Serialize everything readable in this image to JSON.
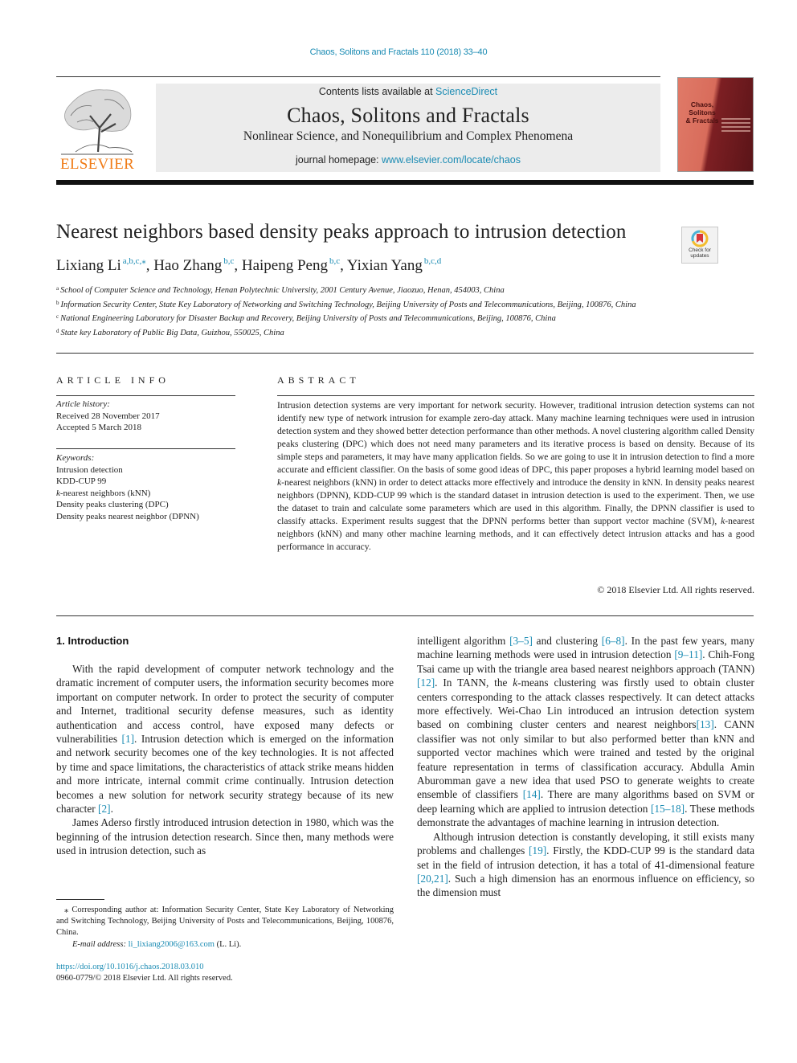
{
  "header": {
    "citation": "Chaos, Solitons and Fractals 110 (2018) 33–40",
    "contents_prefix": "Contents lists available at ",
    "contents_link": "ScienceDirect",
    "journal_name": "Chaos, Solitons and Fractals",
    "journal_subtitle": "Nonlinear Science, and Nonequilibrium and Complex Phenomena",
    "homepage_prefix": "journal homepage: ",
    "homepage_link": "www.elsevier.com/locate/chaos",
    "publisher": "ELSEVIER",
    "cover_title_lines": [
      "Chaos,",
      "Solitons",
      "& Fractals"
    ],
    "check_updates": [
      "Check for",
      "updates"
    ]
  },
  "article": {
    "title": "Nearest neighbors based density peaks approach to intrusion detection",
    "authors": [
      {
        "name": "Lixiang Li",
        "affil": "a,b,c,⁎"
      },
      {
        "name": "Hao Zhang",
        "affil": "b,c"
      },
      {
        "name": "Haipeng Peng",
        "affil": "b,c"
      },
      {
        "name": "Yixian Yang",
        "affil": "b,c,d"
      }
    ],
    "affiliations": [
      {
        "key": "a",
        "text": "School of Computer Science and Technology, Henan Polytechnic University, 2001 Century Avenue, Jiaozuo, Henan, 454003, China"
      },
      {
        "key": "b",
        "text": "Information Security Center, State Key Laboratory of Networking and Switching Technology, Beijing University of Posts and Telecommunications, Beijing, 100876, China"
      },
      {
        "key": "c",
        "text": "National Engineering Laboratory for Disaster Backup and Recovery, Beijing University of Posts and Telecommunications, Beijing, 100876, China"
      },
      {
        "key": "d",
        "text": "State key Laboratory of Public Big Data, Guizhou, 550025, China"
      }
    ]
  },
  "article_info": {
    "heading": "ARTICLE INFO",
    "history_label": "Article history:",
    "received": "Received 28 November 2017",
    "accepted": "Accepted 5 March 2018",
    "keywords_label": "Keywords:",
    "keywords": [
      "Intrusion detection",
      "KDD-CUP 99",
      "k-nearest neighbors (kNN)",
      "Density peaks clustering (DPC)",
      "Density peaks nearest neighbor (DPNN)"
    ]
  },
  "abstract": {
    "heading": "ABSTRACT",
    "text": "Intrusion detection systems are very important for network security. However, traditional intrusion detection systems can not identify new type of network intrusion for example zero-day attack. Many machine learning techniques were used in intrusion detection system and they showed better detection performance than other methods. A novel clustering algorithm called Density peaks clustering (DPC) which does not need many parameters and its iterative process is based on density. Because of its simple steps and parameters, it may have many application fields. So we are going to use it in intrusion detection to find a more accurate and efficient classifier. On the basis of some good ideas of DPC, this paper proposes a hybrid learning model based on k-nearest neighbors (kNN) in order to detect attacks more effectively and introduce the density in kNN. In density peaks nearest neighbors (DPNN), KDD-CUP 99 which is the standard dataset in intrusion detection is used to the experiment. Then, we use the dataset to train and calculate some parameters which are used in this algorithm. Finally, the DPNN classifier is used to classify attacks. Experiment results suggest that the DPNN performs better than support vector machine (SVM), k-nearest neighbors (kNN) and many other machine learning methods, and it can effectively detect intrusion attacks and has a good performance in accuracy.",
    "copyright": "© 2018 Elsevier Ltd. All rights reserved."
  },
  "body": {
    "section_heading": "1. Introduction",
    "left_paragraphs": [
      [
        {
          "t": "With the rapid development of computer network technology and the dramatic increment of computer users, the information security becomes more important on computer network. In order to protect the security of computer and Internet, traditional security defense measures, such as identity authentication and access control, have exposed many defects or vulnerabilities "
        },
        {
          "ref": "[1]"
        },
        {
          "t": ". Intrusion detection which is emerged on the information and network security becomes one of the key technologies. It is not affected by time and space limitations, the characteristics of attack strike means hidden and more intricate, internal commit crime continually. Intrusion detection becomes a new solution for network security strategy because of its new character "
        },
        {
          "ref": "[2]"
        },
        {
          "t": "."
        }
      ],
      [
        {
          "t": "James Aderso firstly introduced intrusion detection in 1980, which was the beginning of the intrusion detection research. Since then, many methods were used in intrusion detection, such as"
        }
      ]
    ],
    "right_paragraphs": [
      [
        {
          "t": "intelligent algorithm "
        },
        {
          "ref": "[3–5]"
        },
        {
          "t": " and clustering "
        },
        {
          "ref": "[6–8]"
        },
        {
          "t": ". In the past few years, many machine learning methods were used in intrusion detection "
        },
        {
          "ref": "[9–11]"
        },
        {
          "t": ". Chih-Fong Tsai came up with the triangle area based nearest neighbors approach (TANN) "
        },
        {
          "ref": "[12]"
        },
        {
          "t": ". In TANN, the k-means clustering was firstly used to obtain cluster centers corresponding to the attack classes respectively. It can detect attacks more effectively. Wei-Chao Lin introduced an intrusion detection system based on combining cluster centers and nearest neighbors"
        },
        {
          "ref": "[13]"
        },
        {
          "t": ". CANN classifier was not only similar to but also performed better than kNN and supported vector machines which were trained and tested by the original feature representation in terms of classification accuracy. Abdulla Amin Aburomman gave a new idea that used PSO to generate weights to create ensemble of classifiers "
        },
        {
          "ref": "[14]"
        },
        {
          "t": ". There are many algorithms based on SVM or deep learning which are applied to intrusion detection "
        },
        {
          "ref": "[15–18]"
        },
        {
          "t": ". These methods demonstrate the advantages of machine learning in intrusion detection."
        }
      ],
      [
        {
          "t": "Although intrusion detection is constantly developing, it still exists many problems and challenges "
        },
        {
          "ref": "[19]"
        },
        {
          "t": ". Firstly, the KDD-CUP 99 is the standard data set in the field of intrusion detection, it has a total of 41-dimensional feature "
        },
        {
          "ref": "[20,21]"
        },
        {
          "t": ". Such a high dimension has an enormous influence on efficiency, so the dimension must"
        }
      ]
    ]
  },
  "footer": {
    "corresponding_note": "⁎ Corresponding author at: Information Security Center, State Key Laboratory of Networking and Switching Technology, Beijing University of Posts and Telecommunications, Beijing, 100876, China.",
    "email_label": "E-mail address: ",
    "email": "li_lixiang2006@163.com",
    "email_suffix": " (L. Li).",
    "doi": "https://doi.org/10.1016/j.chaos.2018.03.010",
    "issn": "0960-0779/© 2018 Elsevier Ltd. All rights reserved."
  },
  "colors": {
    "link": "#1a8bb3",
    "elsevier_orange": "#f07b16",
    "masthead_bg": "#ececec"
  }
}
